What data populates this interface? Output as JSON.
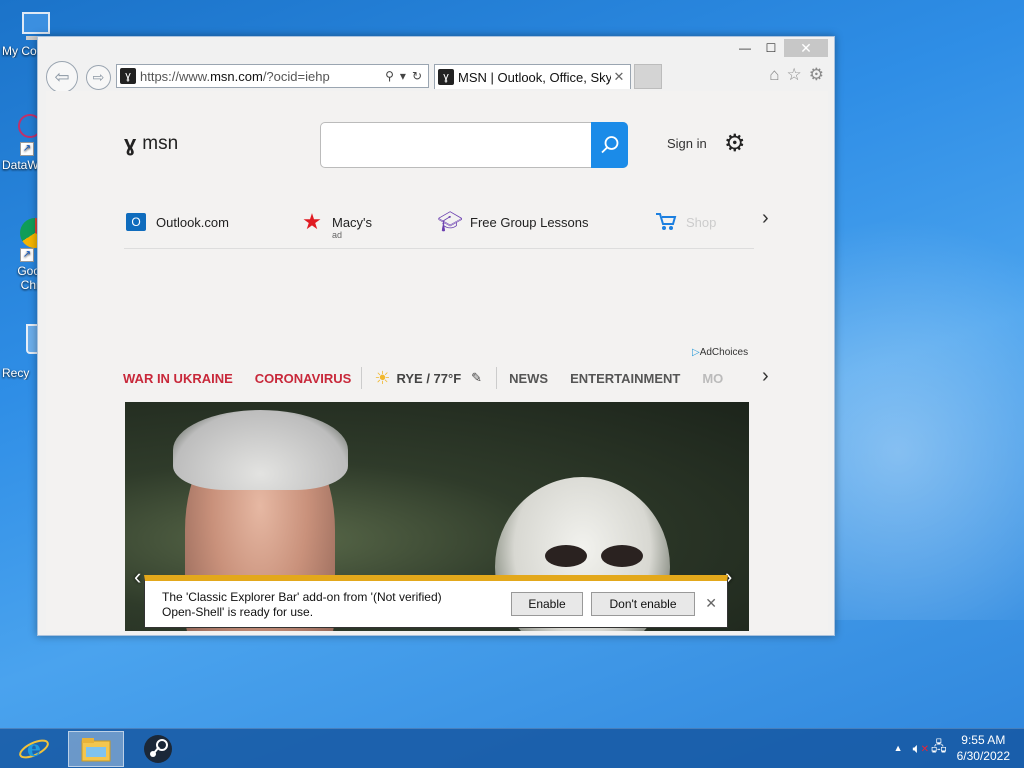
{
  "desktop": {
    "icons": [
      {
        "label": "My Co"
      },
      {
        "label": "DataW"
      },
      {
        "label": "Goo Chr"
      },
      {
        "label": "Recy"
      }
    ]
  },
  "window": {
    "controls": {
      "minimize": "—",
      "maximize": "☐",
      "close": "✕"
    },
    "address": {
      "url_prefix": "https://www.",
      "url_domain": "msn.com",
      "url_suffix": "/?ocid=iehp"
    },
    "tab": {
      "title": "MSN | Outlook, Office, Sky...",
      "close": "✕"
    }
  },
  "msn": {
    "logo_text": "msn",
    "search": {
      "placeholder": ""
    },
    "sign_in": "Sign in",
    "quick_links": [
      {
        "label": "Outlook.com",
        "ad": ""
      },
      {
        "label": "Macy's",
        "ad": "ad"
      },
      {
        "label": "Free Group Lessons",
        "ad": ""
      },
      {
        "label": "Shop",
        "ad": ""
      }
    ],
    "ad_choices": "AdChoices",
    "categories": {
      "ukraine": "WAR IN UKRAINE",
      "corona": "CORONAVIRUS",
      "weather": "RYE / 77°F",
      "news": "NEWS",
      "entertainment": "ENTERTAINMENT",
      "more": "MO"
    }
  },
  "notification": {
    "message_line1": "The 'Classic Explorer Bar' add-on from '(Not verified)",
    "message_line2": "Open-Shell' is ready for use.",
    "enable": "Enable",
    "dont_enable": "Don't enable",
    "close": "✕"
  },
  "taskbar": {
    "time": "9:55 AM",
    "date": "6/30/2022"
  },
  "colors": {
    "accent": "#1b8be8",
    "category_red": "#c8283a",
    "notify_bar": "#e3a81b"
  }
}
